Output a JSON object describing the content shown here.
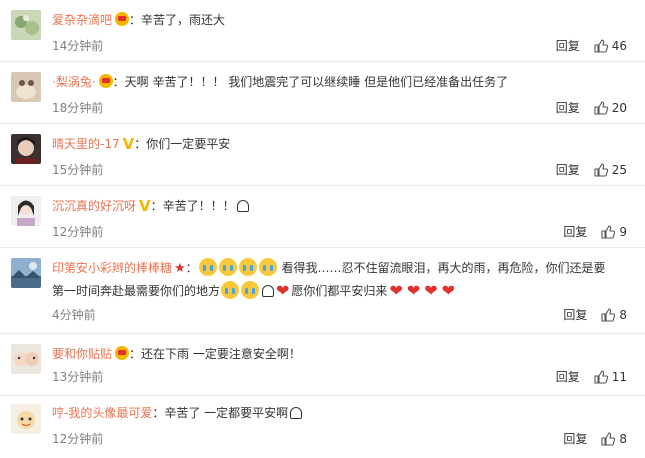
{
  "comments": [
    {
      "name": "爱杂杂滴吧",
      "text": "辛苦了，雨还大",
      "time": "14分钟前",
      "reply_label": "回复",
      "likes": "46"
    },
    {
      "name": "·梨涡兔·",
      "text": "天啊 辛苦了！！！ 我们地震完了可以继续睡 但是他们已经准备出任务了",
      "time": "18分钟前",
      "reply_label": "回复",
      "likes": "20"
    },
    {
      "name": "晴天里的-17",
      "text": "你们一定要平安",
      "time": "15分钟前",
      "reply_label": "回复",
      "likes": "25"
    },
    {
      "name": "沉沉真的好沉呀",
      "text": "辛苦了！！！",
      "time": "12分钟前",
      "reply_label": "回复",
      "likes": "9"
    },
    {
      "name": "印第安小彩辫的棒棒糖",
      "text_a": "看得我……忍不住留流眼泪，再大的雨，再危险，你们还是要",
      "text_b": "第一时间奔赴最需要你们的地方",
      "text_c": "愿你们都平安归来",
      "time": "4分钟前",
      "reply_label": "回复",
      "likes": "8"
    },
    {
      "name": "要和你贴贴",
      "text": "还在下雨 一定要注意安全啊！",
      "time": "13分钟前",
      "reply_label": "回复",
      "likes": "11"
    },
    {
      "name": "哼-我的头像最可爱",
      "text": "辛苦了 一定都要平安啊",
      "time": "12分钟前",
      "reply_label": "回复",
      "likes": "8"
    }
  ],
  "separator": "：",
  "colors": {
    "username": "#eb7350",
    "time": "#808080",
    "badge_gold": "#f7b500",
    "heart": "#e0322b"
  },
  "icons": {
    "like": "thumbs-up-icon",
    "vip_badge": "crown-badge-icon",
    "verified_badge": "v-badge-icon",
    "emoji_cry": "crying-face-emoji",
    "emoji_heart": "heart-emoji",
    "emoji_ghost": "ghost-emoji"
  }
}
